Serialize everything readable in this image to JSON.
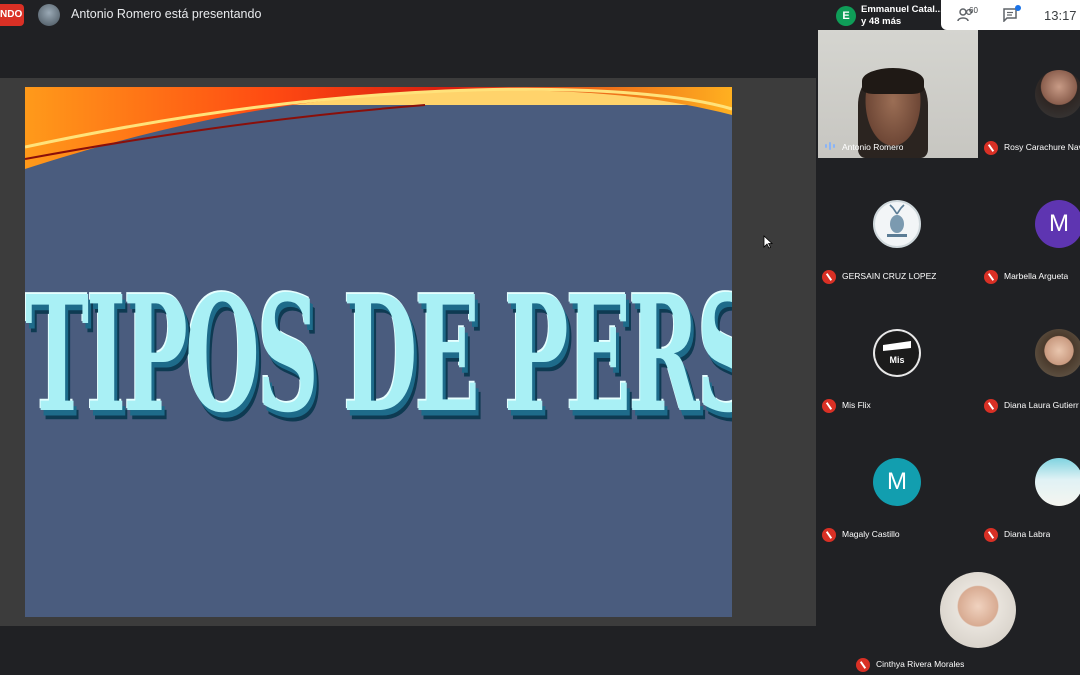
{
  "topbar": {
    "recording_label": "NDO",
    "presenting_text": "Antonio Romero está presentando",
    "participant_chip": {
      "avatar_letter": "E",
      "name": "Emmanuel Catal...",
      "more": "y 48 más"
    },
    "people_count": "60",
    "clock": "13:17",
    "icons": [
      "people-icon",
      "chat-icon"
    ]
  },
  "slide": {
    "title": "TIPOS DE PERSONALIDADES"
  },
  "participants": [
    {
      "name": "Antonio Romero",
      "type": "video",
      "mic": "speaking"
    },
    {
      "name": "Rosy Carachure Nav",
      "type": "photo",
      "mic": "muted"
    },
    {
      "name": "GERSAIN CRUZ LOPEZ",
      "type": "photo",
      "mic": "muted"
    },
    {
      "name": "Marbella Argueta",
      "type": "letter",
      "letter": "M",
      "color": "#5e35b1",
      "mic": "muted"
    },
    {
      "name": "Mis Flix",
      "type": "logo",
      "logo_text": "MisFlix",
      "mic": "muted"
    },
    {
      "name": "Diana Laura Gutierr",
      "type": "photo",
      "mic": "muted"
    },
    {
      "name": "Magaly Castillo",
      "type": "letter",
      "letter": "M",
      "color": "#129eaf",
      "mic": "muted"
    },
    {
      "name": "Diana Labra",
      "type": "photo",
      "mic": "muted"
    },
    {
      "name": "Cinthya Rivera Morales",
      "type": "photo",
      "mic": "muted"
    }
  ],
  "colors": {
    "record": "#d93025",
    "background": "#202124",
    "slide_bg": "#4a5c7e",
    "title": "#a9f0f5"
  }
}
